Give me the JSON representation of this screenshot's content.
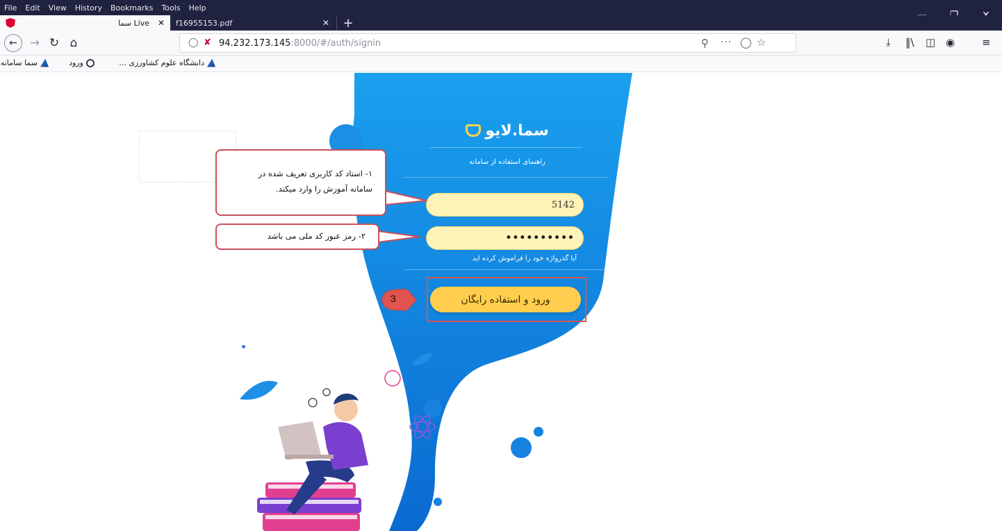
{
  "browser": {
    "menu": [
      "File",
      "Edit",
      "View",
      "History",
      "Bookmarks",
      "Tools",
      "Help"
    ],
    "tabs": [
      {
        "title": "Live سما"
      },
      {
        "title": "f16955153.pdf"
      }
    ],
    "url": {
      "host": "94.232.173.145",
      "rest": ":8000/#/auth/signin"
    },
    "bookmarks": [
      "سما سامانه",
      "ورود",
      "دانشگاه علوم کشاورزی ..."
    ]
  },
  "login": {
    "logo": "سما.لایو",
    "guide_link": "راهنمای استفاده از سامانه",
    "username_value": "5142",
    "password_value": "••••••••••",
    "forgot_link": "آیا گذرواژه خود را فراموش کرده اید",
    "submit_label": "ورود و استفاده رایگان"
  },
  "annotations": {
    "callout_1_line_1": "۱- استاد کد کاربری تعریف شده در",
    "callout_1_line_2": "سامانه آموزش را وارد میکند.",
    "callout_2": "۲- رمز عبور کد ملی می باشد",
    "step_3": "3"
  },
  "colors": {
    "blob_top": "#1493e6",
    "blob_bottom": "#0a6fd6",
    "field_bg": "#fff3b8",
    "button_bg": "#ffce4f",
    "callout_border": "#c8505a",
    "marker_red": "#d9534f"
  }
}
